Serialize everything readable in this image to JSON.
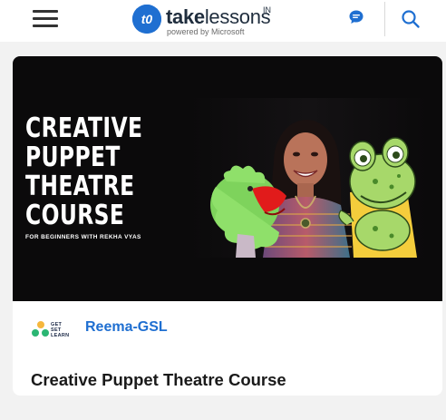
{
  "header": {
    "logo": {
      "brand_bold": "take",
      "brand_light": "lessons",
      "superscript": "IN",
      "tagline": "powered by Microsoft",
      "badge_text": "t0"
    },
    "icons": {
      "menu": "hamburger-menu-icon",
      "chat": "chat-bubble-icon",
      "search": "magnifier-icon"
    }
  },
  "course_card": {
    "banner": {
      "title_lines": [
        "CREATIVE",
        "PUPPET",
        "THEATRE",
        "COURSE"
      ],
      "subtitle": "FOR BEGINNERS WITH REKHA VYAS"
    },
    "author": {
      "logo_lines": [
        "GET",
        "SET",
        "LEARN"
      ],
      "name": "Reema-GSL"
    },
    "title": "Creative Puppet Theatre Course"
  },
  "colors": {
    "accent": "#1f6fd1",
    "banner_bg": "#0b0a0b",
    "page_bg": "#f2f2f2"
  }
}
